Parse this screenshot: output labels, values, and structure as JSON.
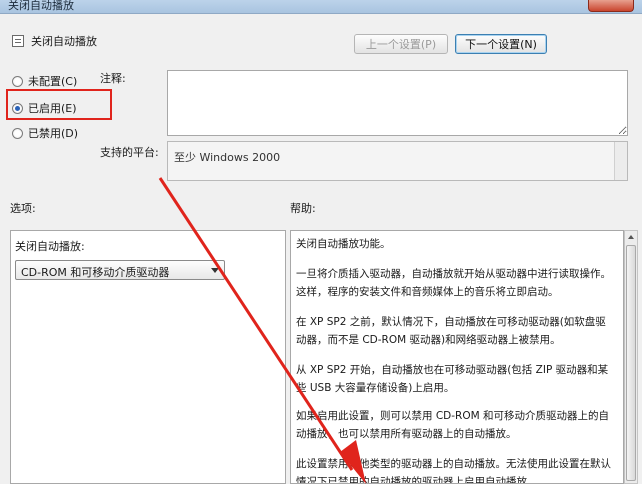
{
  "window": {
    "title": "关闭自动播放"
  },
  "policy": {
    "name": "关闭自动播放"
  },
  "nav": {
    "prev_label": "上一个设置(P)",
    "next_label": "下一个设置(N)"
  },
  "state": {
    "not_configured_label": "未配置(C)",
    "enabled_label": "已启用(E)",
    "disabled_label": "已禁用(D)",
    "selected": "enabled"
  },
  "comment": {
    "label": "注释:",
    "value": ""
  },
  "platform": {
    "label": "支持的平台:",
    "value": "至少 Windows 2000"
  },
  "options": {
    "label": "选项:",
    "field_label": "关闭自动播放:",
    "dropdown_value": "CD-ROM 和可移动介质驱动器"
  },
  "help": {
    "label": "帮助:",
    "paragraphs": [
      "关闭自动播放功能。",
      "一旦将介质插入驱动器，自动播放就开始从驱动器中进行读取操作。这样，程序的安装文件和音频媒体上的音乐将立即启动。",
      "在 XP SP2 之前，默认情况下，自动播放在可移动驱动器(如软盘驱动器，而不是 CD-ROM 驱动器)和网络驱动器上被禁用。",
      "从 XP SP2 开始，自动播放也在可移动驱动器(包括 ZIP 驱动器和某些 USB 大容量存储设备)上启用。",
      "如果启用此设置，则可以禁用 CD-ROM 和可移动介质驱动器上的自动播放，也可以禁用所有驱动器上的自动播放。",
      "此设置禁用其他类型的驱动器上的自动播放。无法使用此设置在默认情况下已禁用的自动播放的驱动器上启用自动播放。"
    ]
  },
  "colors": {
    "annotation_red": "#e0241c",
    "selected_radio": "#2a62b8"
  }
}
